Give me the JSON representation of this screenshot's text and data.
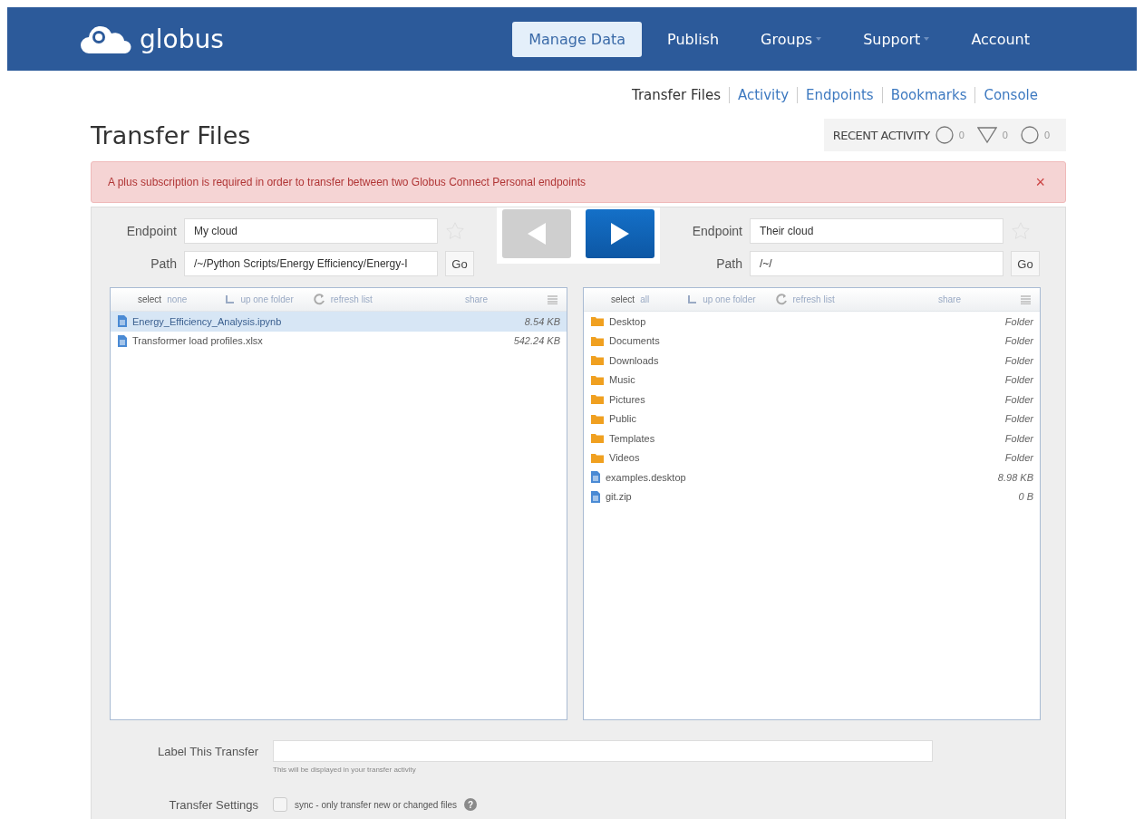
{
  "header": {
    "logo_text": "globus",
    "nav": [
      {
        "label": "Manage Data",
        "selected": true,
        "dropdown": false
      },
      {
        "label": "Publish",
        "selected": false,
        "dropdown": false
      },
      {
        "label": "Groups",
        "selected": false,
        "dropdown": true
      },
      {
        "label": "Support",
        "selected": false,
        "dropdown": true
      },
      {
        "label": "Account",
        "selected": false,
        "dropdown": false
      }
    ]
  },
  "subnav": [
    {
      "label": "Transfer Files",
      "selected": true
    },
    {
      "label": "Activity",
      "selected": false
    },
    {
      "label": "Endpoints",
      "selected": false
    },
    {
      "label": "Bookmarks",
      "selected": false
    },
    {
      "label": "Console",
      "selected": false
    }
  ],
  "page_title": "Transfer Files",
  "recent_activity": {
    "label": "RECENT ACTIVITY",
    "counts": [
      {
        "kind": "circle",
        "count": "0"
      },
      {
        "kind": "triangle",
        "count": "0"
      },
      {
        "kind": "circle",
        "count": "0"
      }
    ]
  },
  "alert": {
    "text": "A plus subscription is required in order to transfer between two Globus Connect Personal endpoints",
    "dismiss": "×"
  },
  "arrows": [
    {
      "kind": "left",
      "enabled": false
    },
    {
      "kind": "right",
      "enabled": true
    }
  ],
  "panes": [
    {
      "endpoint_label": "Endpoint",
      "endpoint_value": "My cloud",
      "path_label": "Path",
      "path_value": "/~/Python Scripts/Energy Efficiency/Energy-I",
      "go": "Go",
      "bookmarked": false,
      "toolbar": {
        "select": "select",
        "select_option": "none",
        "up": "up one folder",
        "refresh": "refresh list",
        "share": "share"
      },
      "files": [
        {
          "name": "Energy_Efficiency_Analysis.ipynb",
          "size": "8.54 KB",
          "kind": "file",
          "selected": true
        },
        {
          "name": "Transformer load profiles.xlsx",
          "size": "542.24 KB",
          "kind": "file",
          "selected": false
        }
      ]
    },
    {
      "endpoint_label": "Endpoint",
      "endpoint_value": "Their cloud",
      "path_label": "Path",
      "path_value": "/~/",
      "go": "Go",
      "bookmarked": false,
      "toolbar": {
        "select": "select",
        "select_option": "all",
        "up": "up one folder",
        "refresh": "refresh list",
        "share": "share"
      },
      "files": [
        {
          "name": "Desktop",
          "size": "Folder",
          "kind": "folder",
          "selected": false
        },
        {
          "name": "Documents",
          "size": "Folder",
          "kind": "folder",
          "selected": false
        },
        {
          "name": "Downloads",
          "size": "Folder",
          "kind": "folder",
          "selected": false
        },
        {
          "name": "Music",
          "size": "Folder",
          "kind": "folder",
          "selected": false
        },
        {
          "name": "Pictures",
          "size": "Folder",
          "kind": "folder",
          "selected": false
        },
        {
          "name": "Public",
          "size": "Folder",
          "kind": "folder",
          "selected": false
        },
        {
          "name": "Templates",
          "size": "Folder",
          "kind": "folder",
          "selected": false
        },
        {
          "name": "Videos",
          "size": "Folder",
          "kind": "folder",
          "selected": false
        },
        {
          "name": "examples.desktop",
          "size": "8.98 KB",
          "kind": "file",
          "selected": false
        },
        {
          "name": "git.zip",
          "size": "0 B",
          "kind": "file",
          "selected": false
        }
      ]
    }
  ],
  "label_transfer": {
    "label": "Label This Transfer",
    "hint": "This will be displayed in your transfer activity"
  },
  "settings": {
    "label": "Transfer Settings",
    "sync": {
      "text": "sync - only transfer new or changed files",
      "checked": false
    },
    "help": "?"
  }
}
